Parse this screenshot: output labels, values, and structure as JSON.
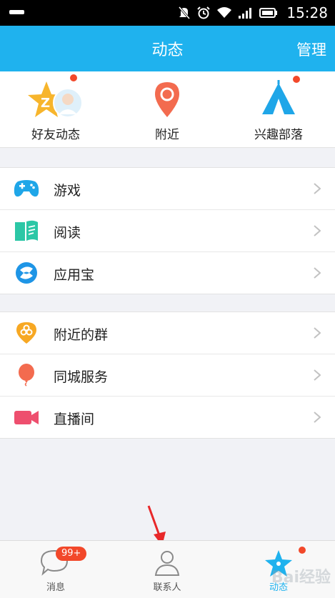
{
  "status": {
    "time": "15:28"
  },
  "header": {
    "title": "动态",
    "manage_label": "管理"
  },
  "quick": [
    {
      "label": "好友动态",
      "icon": "qzone-star-icon",
      "dot": true
    },
    {
      "label": "附近",
      "icon": "location-pin-icon",
      "dot": false
    },
    {
      "label": "兴趣部落",
      "icon": "tent-icon",
      "dot": true
    }
  ],
  "group1": [
    {
      "label": "游戏",
      "icon": "gamepad-icon"
    },
    {
      "label": "阅读",
      "icon": "book-icon"
    },
    {
      "label": "应用宝",
      "icon": "appstore-icon"
    }
  ],
  "group2": [
    {
      "label": "附近的群",
      "icon": "nearby-group-icon"
    },
    {
      "label": "同城服务",
      "icon": "balloon-icon"
    },
    {
      "label": "直播间",
      "icon": "video-camera-icon"
    }
  ],
  "tabs": [
    {
      "label": "消息",
      "badge": "99+"
    },
    {
      "label": "联系人"
    },
    {
      "label": "动态",
      "active": true
    }
  ],
  "colors": {
    "accent": "#1fb2ee",
    "dot": "#f2482a"
  },
  "watermark": "Bai经验"
}
